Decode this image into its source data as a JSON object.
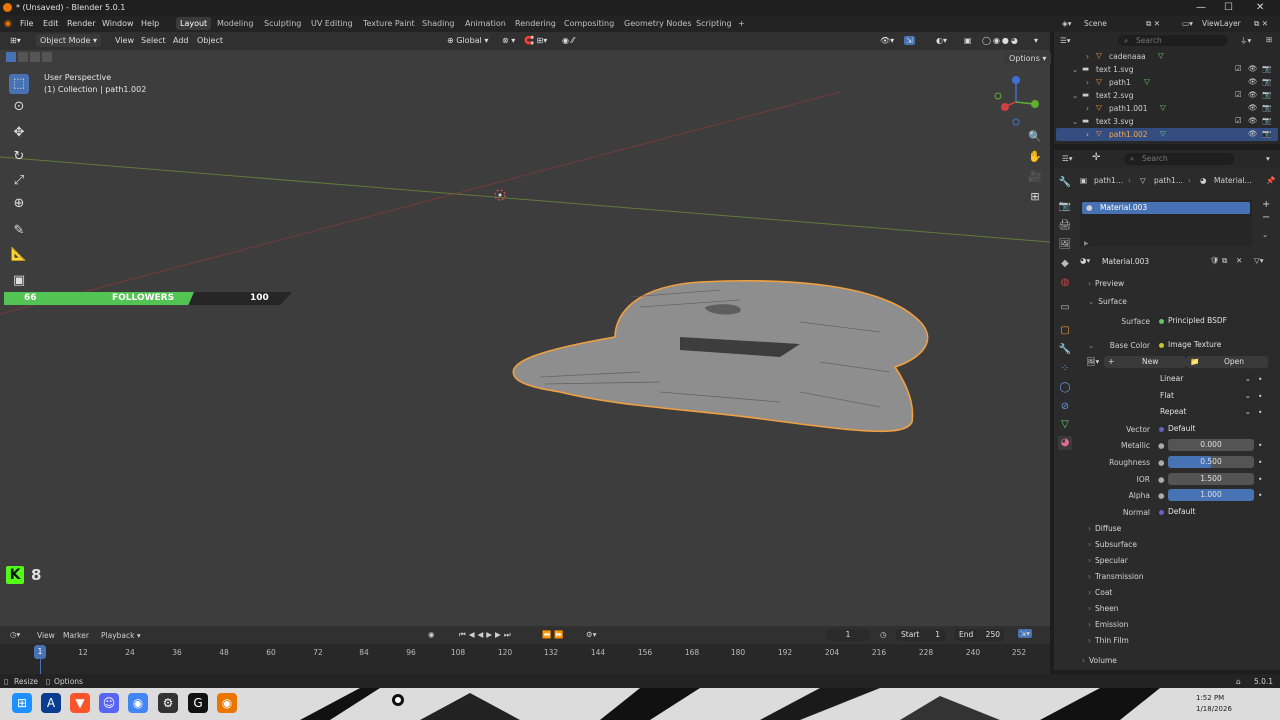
{
  "window": {
    "title": "* (Unsaved) - Blender 5.0.1",
    "min": "—",
    "max": "☐",
    "close": "✕"
  },
  "menu": {
    "items": [
      "File",
      "Edit",
      "Render",
      "Window",
      "Help"
    ]
  },
  "workspaces": [
    "Layout",
    "Modeling",
    "Sculpting",
    "UV Editing",
    "Texture Paint",
    "Shading",
    "Animation",
    "Rendering",
    "Compositing",
    "Geometry Nodes",
    "Scripting",
    "+"
  ],
  "viewport": {
    "mode": "Object Mode",
    "menus": [
      "View",
      "Select",
      "Add",
      "Object"
    ],
    "transform_orientation": "Global",
    "options": "Options",
    "overlay_title": "User Perspective",
    "overlay_sub": "(1) Collection | path1.002",
    "followers": {
      "left": "66",
      "label": "FOLLOWERS",
      "right": "100",
      "fraction": 0.66
    },
    "kick_count": "8",
    "kick_logo": "K"
  },
  "outliner": {
    "scene": "Scene",
    "view_layer": "ViewLayer",
    "search_placeholder": "Search",
    "rows": [
      {
        "name": "cadenaaa",
        "selected": false
      },
      {
        "name": "text 1.svg",
        "selected": false
      },
      {
        "name": "path1",
        "selected": false
      },
      {
        "name": "text 2.svg",
        "selected": false
      },
      {
        "name": "path1.001",
        "selected": false
      },
      {
        "name": "text 3.svg",
        "selected": false
      },
      {
        "name": "path1.002",
        "selected": true
      }
    ]
  },
  "properties": {
    "search_placeholder": "Search",
    "breadcrumb": [
      "path1...",
      "path1...",
      "Material..."
    ],
    "slot": "Material.003",
    "material_name": "Material.003",
    "sections": {
      "preview": "Preview",
      "surface": "Surface"
    },
    "surface_label": "Surface",
    "surface_value": "Principled BSDF",
    "base_color_label": "Base Color",
    "base_color_value": "Image Texture",
    "new_label": "New",
    "open_label": "Open",
    "interpolation": "Linear",
    "projection": "Flat",
    "extension": "Repeat",
    "vector_label": "Vector",
    "vector_value": "Default",
    "metallic_label": "Metallic",
    "metallic_value": "0.000",
    "roughness_label": "Roughness",
    "roughness_value": "0.500",
    "roughness_fraction": 0.5,
    "ior_label": "IOR",
    "ior_value": "1.500",
    "alpha_label": "Alpha",
    "alpha_value": "1.000",
    "alpha_fraction": 1.0,
    "normal_label": "Normal",
    "normal_value": "Default",
    "collapsed": [
      "Diffuse",
      "Subsurface",
      "Specular",
      "Transmission",
      "Coat",
      "Sheen",
      "Emission",
      "Thin Film"
    ],
    "volume": "Volume"
  },
  "timeline": {
    "menus": [
      "View",
      "Marker",
      "Playback"
    ],
    "current_frame": "1",
    "start_label": "Start",
    "start": "1",
    "end_label": "End",
    "end": "250",
    "ticks": [
      "1",
      "12",
      "24",
      "36",
      "48",
      "60",
      "72",
      "84",
      "96",
      "108",
      "120",
      "132",
      "144",
      "156",
      "168",
      "180",
      "192",
      "204",
      "216",
      "228",
      "240",
      "252"
    ]
  },
  "status": {
    "resize": "Resize",
    "options": "Options",
    "version": "5.0.1"
  },
  "taskbar": {
    "time": "1:52 PM",
    "date": "1/18/2026"
  }
}
